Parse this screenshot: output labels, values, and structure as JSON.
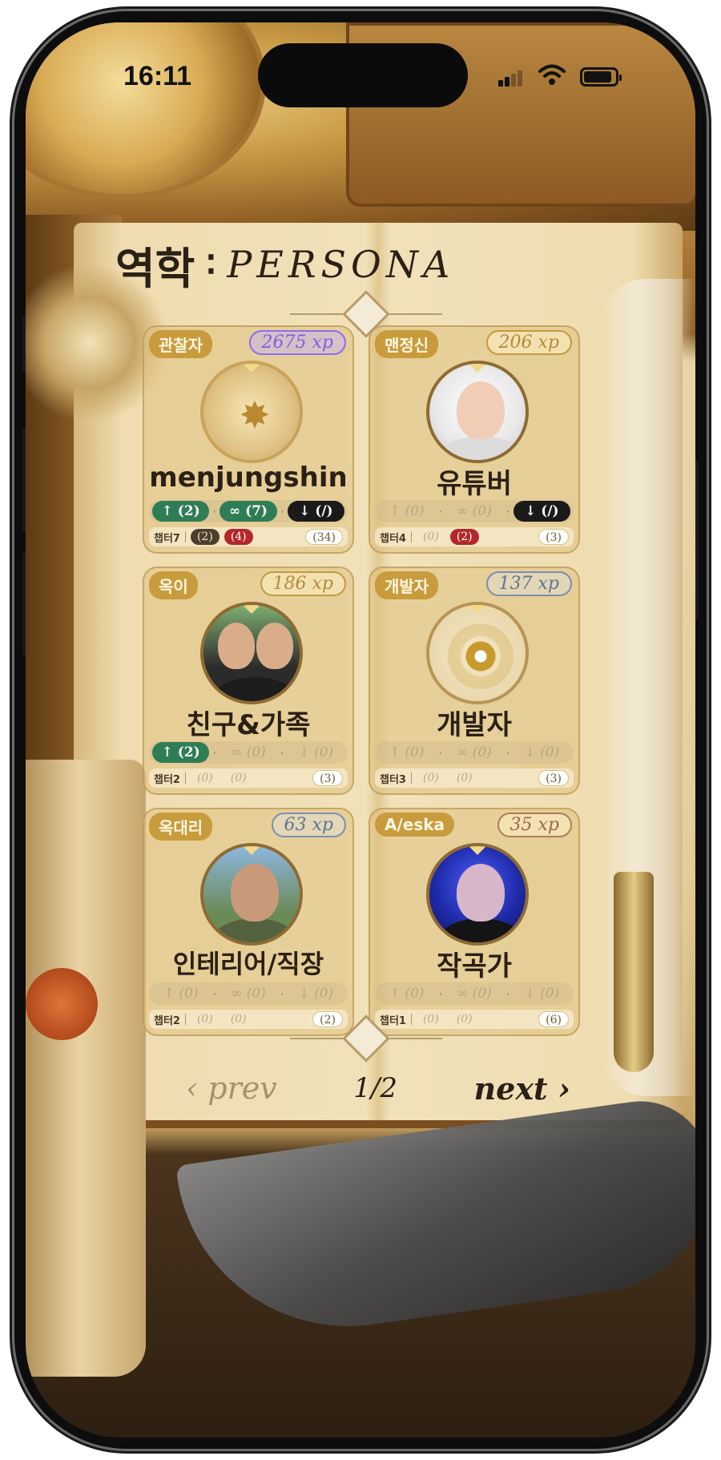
{
  "status_bar": {
    "time": "16:11"
  },
  "header": {
    "title_ko": "역학",
    "title_sep": "∶",
    "title_en": "PERSONA"
  },
  "cards": [
    {
      "role": "관찰자",
      "xp": "2675 xp",
      "name": "menjungshin",
      "avatar": "emblem-icon",
      "stats": [
        "↑ (2)",
        "∞ (7)",
        "↓ (/)"
      ],
      "chapter": "챕터7",
      "pills": [
        "(2)",
        "(4)",
        "(34)"
      ]
    },
    {
      "role": "맨정신",
      "xp": "206 xp",
      "name": "유튜버",
      "avatar": "profile-photo",
      "stats": [
        "↑ (0)",
        "∞ (0)",
        "↓ (/)"
      ],
      "chapter": "챕터4",
      "pills": [
        "(0)",
        "(2)",
        "(3)"
      ]
    },
    {
      "role": "옥이",
      "xp": "186 xp",
      "name": "친구&가족",
      "avatar": "profile-photo",
      "stats": [
        "↑ (2)",
        "∞ (0)",
        "↓ (0)"
      ],
      "chapter": "챕터2",
      "pills": [
        "(0)",
        "(0)",
        "(3)"
      ]
    },
    {
      "role": "개발자",
      "xp": "137 xp",
      "name": "개발자",
      "avatar": "compass-star-icon",
      "stats": [
        "↑ (0)",
        "∞ (0)",
        "↓ (0)"
      ],
      "chapter": "챕터3",
      "pills": [
        "(0)",
        "(0)",
        "(3)"
      ]
    },
    {
      "role": "옥대리",
      "xp": "63 xp",
      "name": "인테리어/직장",
      "avatar": "profile-photo",
      "stats": [
        "↑ (0)",
        "∞ (0)",
        "↓ (0)"
      ],
      "chapter": "챕터2",
      "pills": [
        "(0)",
        "(0)",
        "(2)"
      ]
    },
    {
      "role": "A/eska",
      "xp": "35 xp",
      "name": "작곡가",
      "avatar": "profile-photo",
      "stats": [
        "↑ (0)",
        "∞ (0)",
        "↓ (0)"
      ],
      "chapter": "챕터1",
      "pills": [
        "(0)",
        "(0)",
        "(6)"
      ]
    }
  ],
  "pagination": {
    "prev": "‹ prev",
    "page": "1/2",
    "next": "next ›"
  }
}
